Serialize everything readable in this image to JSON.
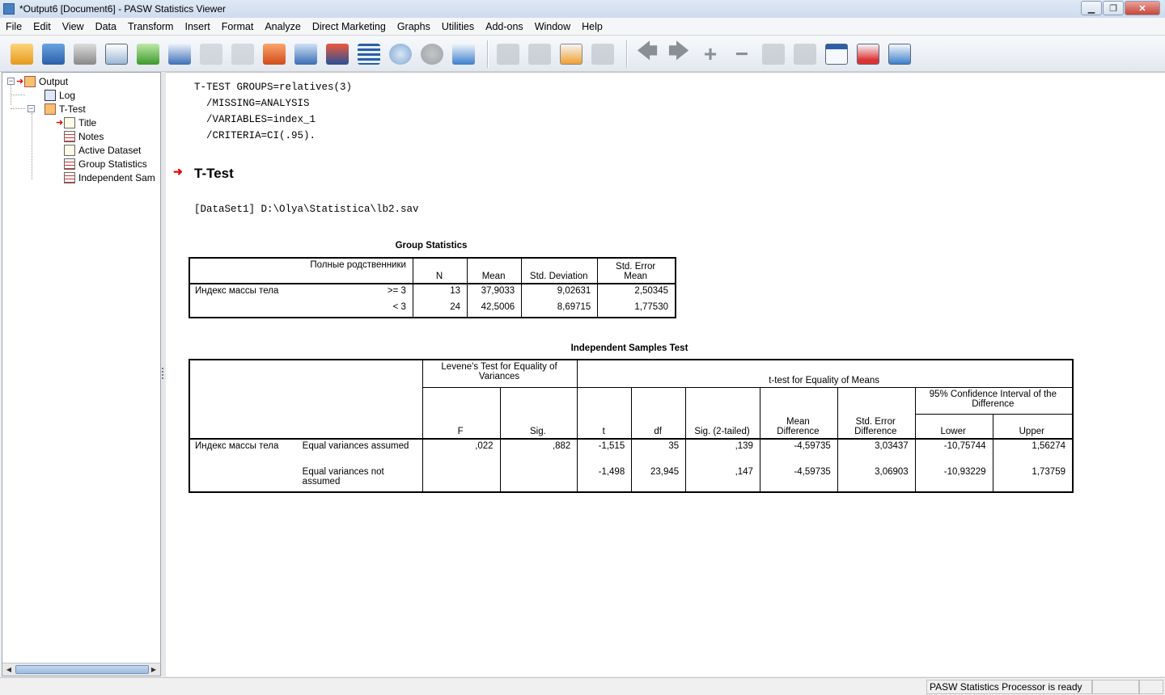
{
  "window": {
    "title": "*Output6 [Document6] - PASW Statistics Viewer"
  },
  "menu": [
    "File",
    "Edit",
    "View",
    "Data",
    "Transform",
    "Insert",
    "Format",
    "Analyze",
    "Direct Marketing",
    "Graphs",
    "Utilities",
    "Add-ons",
    "Window",
    "Help"
  ],
  "navigation": {
    "root": "Output",
    "log": "Log",
    "ttest": "T-Test",
    "children": [
      "Title",
      "Notes",
      "Active Dataset",
      "Group Statistics",
      "Independent Sam"
    ]
  },
  "syntax_lines": [
    "T-TEST GROUPS=relatives(3)",
    "  /MISSING=ANALYSIS",
    "  /VARIABLES=index_1",
    "  /CRITERIA=CI(.95)."
  ],
  "section_title": "T-Test",
  "dataset_line": "[DataSet1] D:\\Olya\\Statistica\\lb2.sav",
  "group_statistics": {
    "caption": "Group Statistics",
    "group_header": "Полные родственники",
    "headers": [
      "N",
      "Mean",
      "Std. Deviation",
      "Std. Error Mean"
    ],
    "variable": "Индекс массы тела",
    "rows": [
      {
        "group": ">= 3",
        "n": "13",
        "mean": "37,9033",
        "sd": "9,02631",
        "se": "2,50345"
      },
      {
        "group": "< 3",
        "n": "24",
        "mean": "42,5006",
        "sd": "8,69715",
        "se": "1,77530"
      }
    ]
  },
  "independent_test": {
    "caption": "Independent Samples Test",
    "levene_header": "Levene's Test for Equality of Variances",
    "ttest_header": "t-test for Equality of Means",
    "ci_header": "95% Confidence Interval of the Difference",
    "col_headers": [
      "F",
      "Sig.",
      "t",
      "df",
      "Sig. (2-tailed)",
      "Mean Difference",
      "Std. Error Difference",
      "Lower",
      "Upper"
    ],
    "variable": "Индекс массы тела",
    "rows": [
      {
        "label": "Equal variances assumed",
        "f": ",022",
        "sig": ",882",
        "t": "-1,515",
        "df": "35",
        "sig2": ",139",
        "md": "-4,59735",
        "sed": "3,03437",
        "lower": "-10,75744",
        "upper": "1,56274"
      },
      {
        "label": "Equal variances not assumed",
        "f": "",
        "sig": "",
        "t": "-1,498",
        "df": "23,945",
        "sig2": ",147",
        "md": "-4,59735",
        "sed": "3,06903",
        "lower": "-10,93229",
        "upper": "1,73759"
      }
    ]
  },
  "status": {
    "message": "PASW Statistics Processor is ready"
  }
}
